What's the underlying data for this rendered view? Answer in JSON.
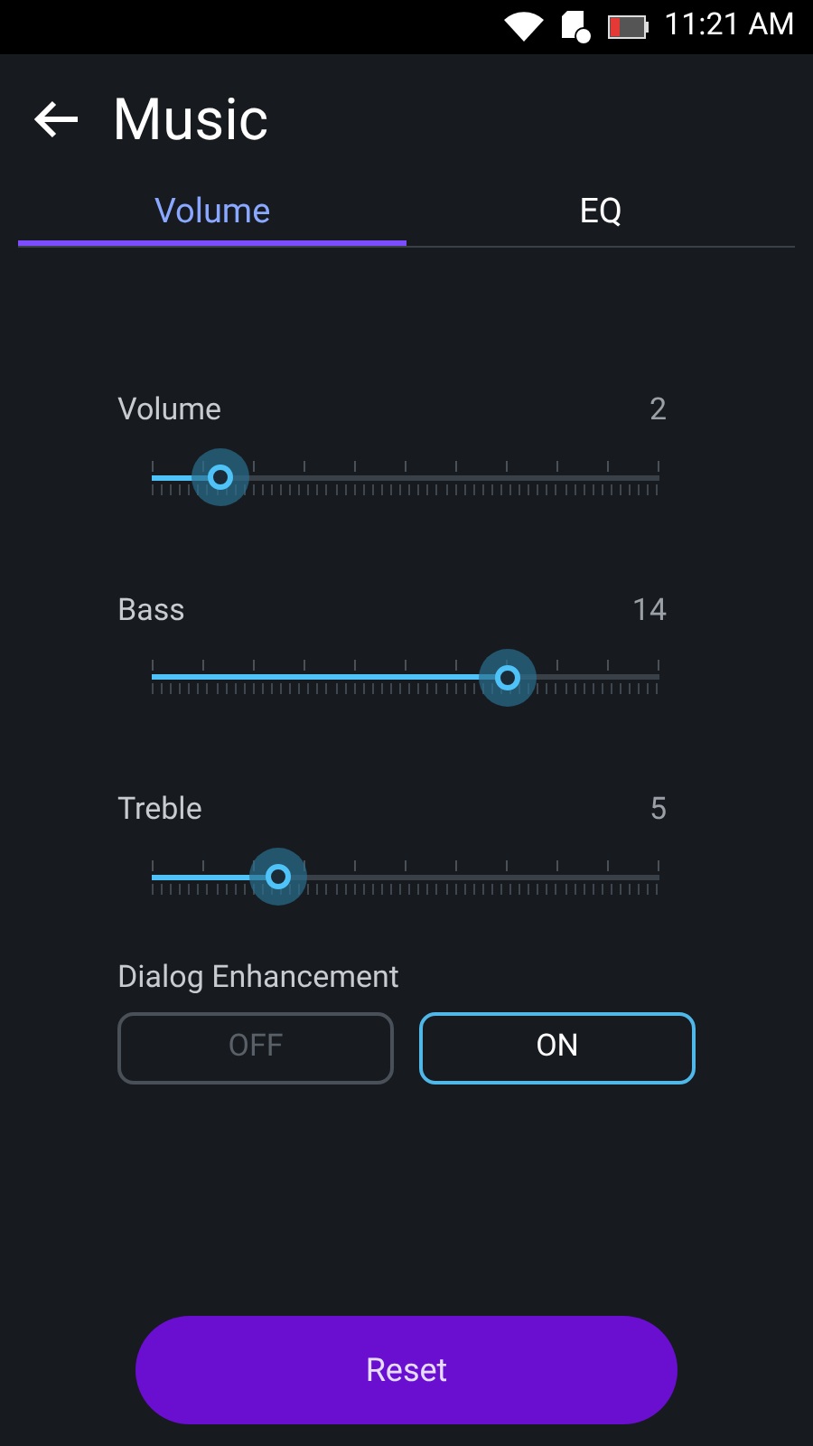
{
  "status_bar": {
    "time": "11:21 AM"
  },
  "header": {
    "title": "Music"
  },
  "tabs": [
    {
      "label": "Volume",
      "selected": true
    },
    {
      "label": "EQ",
      "selected": false
    }
  ],
  "sliders": [
    {
      "label": "Volume",
      "reading": "2",
      "level": 0.135
    },
    {
      "label": "Bass",
      "reading": "14",
      "level": 0.7
    },
    {
      "label": "Treble",
      "reading": "5",
      "level": 0.25
    }
  ],
  "dialog_enhancement": {
    "label": "Dialog Enhancement",
    "options": [
      {
        "label": "OFF",
        "selected": false
      },
      {
        "label": "ON",
        "selected": true
      }
    ]
  },
  "reset_button": "Reset"
}
